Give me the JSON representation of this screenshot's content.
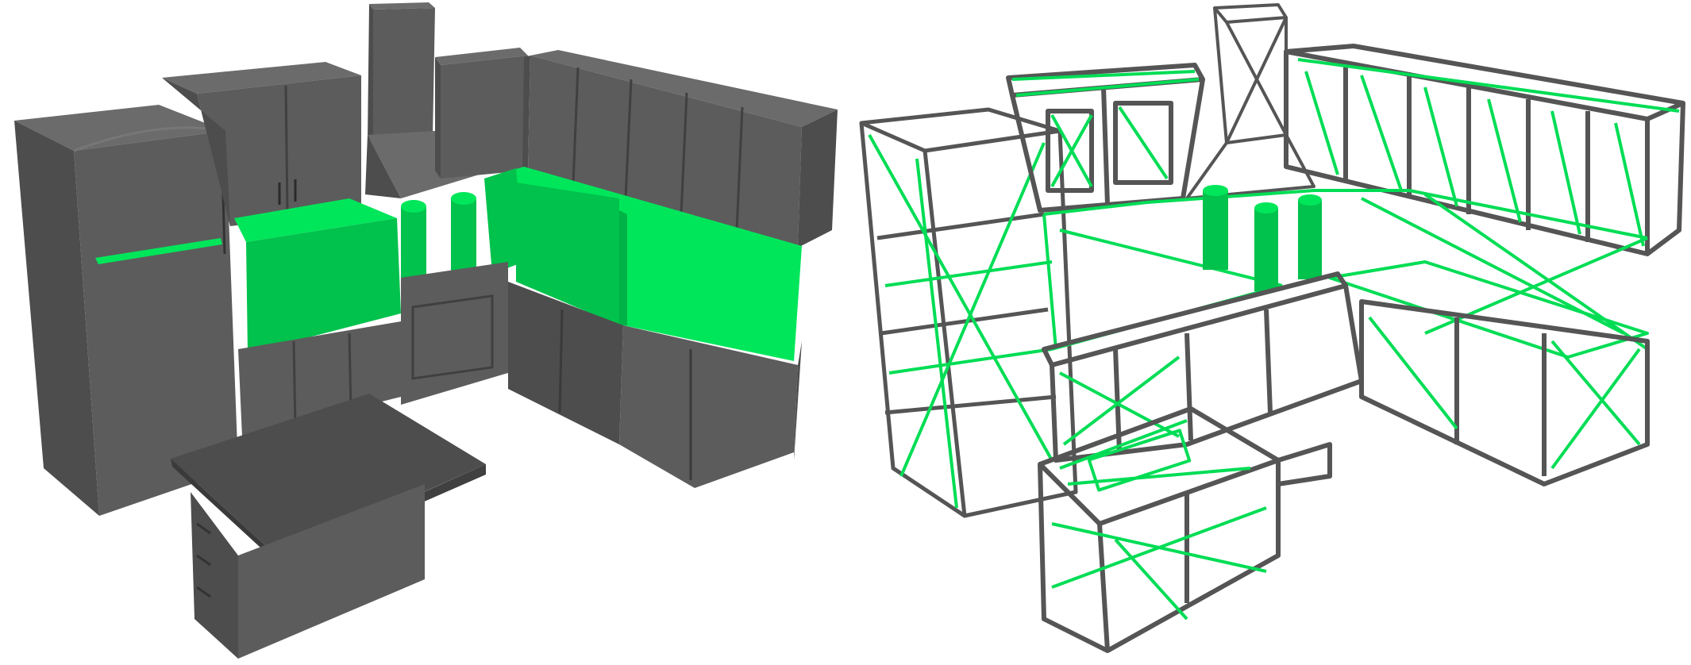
{
  "scene": {
    "subject": "kitchen",
    "colors": {
      "background": "#ffffff",
      "dark_face": "#4d4d4d",
      "mid_face": "#5c5c5c",
      "light_face": "#6b6b6b",
      "outline": "#3a3a3a",
      "highlight": "#00e65a",
      "highlight_dark": "#00c24c",
      "wire_gray": "#555555",
      "wire_green": "#00dd55"
    },
    "views": [
      {
        "id": "solid",
        "render_mode": "solid"
      },
      {
        "id": "wireframe",
        "render_mode": "wireframe"
      }
    ]
  }
}
